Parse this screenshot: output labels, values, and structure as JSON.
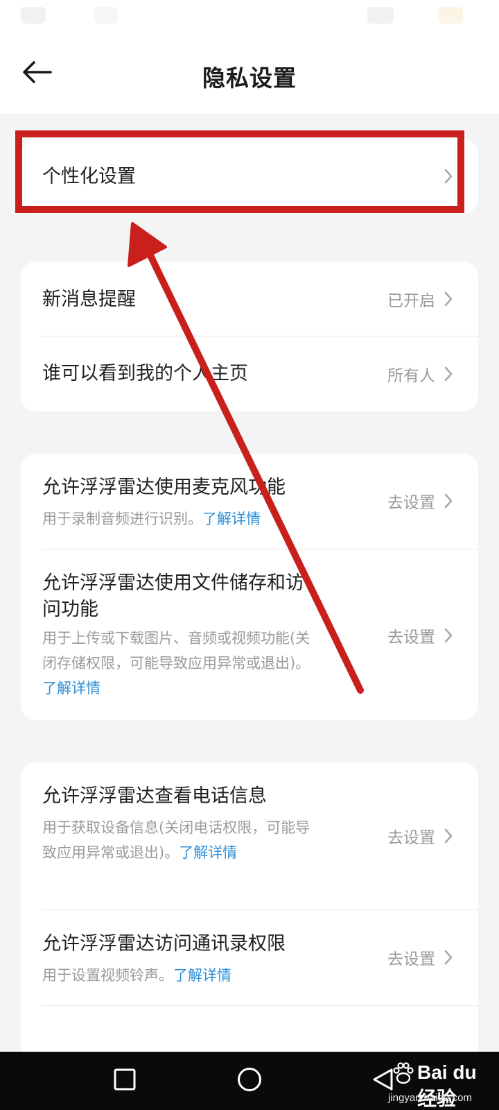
{
  "header": {
    "title": "隐私设置"
  },
  "groups": [
    {
      "rows": [
        {
          "title": "个性化设置"
        }
      ]
    },
    {
      "rows": [
        {
          "title": "新消息提醒",
          "value": "已开启"
        },
        {
          "title": "谁可以看到我的个人主页",
          "value": "所有人"
        }
      ]
    },
    {
      "rows": [
        {
          "title": "允许浮浮雷达使用麦克风功能",
          "desc": "用于录制音频进行识别。",
          "learn_more": "了解详情",
          "value": "去设置"
        },
        {
          "title": "允许浮浮雷达使用文件储存和访问功能",
          "desc": "用于上传或下载图片、音频或视频功能(关闭存储权限，可能导致应用异常或退出)。",
          "learn_more": "了解详情",
          "value": "去设置"
        }
      ]
    },
    {
      "rows": [
        {
          "title": "允许浮浮雷达查看电话信息",
          "desc": "用于获取设备信息(关闭电话权限，可能导致应用异常或退出)。",
          "learn_more": "了解详情",
          "value": "去设置"
        },
        {
          "title": "允许浮浮雷达访问通讯录权限",
          "desc": "用于设置视频铃声。",
          "learn_more": "了解详情",
          "value": "去设置"
        }
      ]
    }
  ],
  "annotation": {
    "color": "#c9201d"
  },
  "watermark": {
    "brand": "Bai du 经验",
    "url": "jingyan.baidu.com"
  },
  "icons": [
    "back-arrow-icon",
    "chevron-right-icon",
    "square-icon",
    "circle-icon",
    "triangle-back-icon",
    "paw-icon"
  ]
}
